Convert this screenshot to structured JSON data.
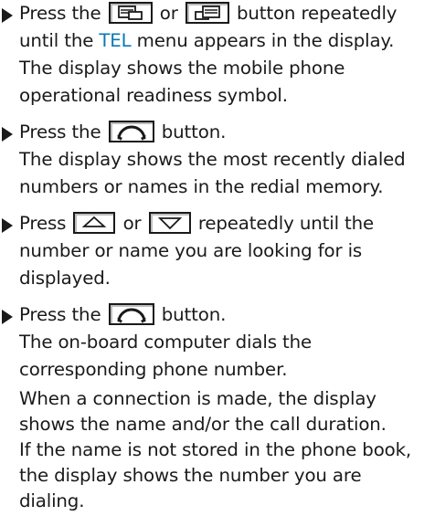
{
  "steps": [
    {
      "lines": [
        {
          "before": "Press the",
          "mid": "or",
          "after": "button repeatedly"
        },
        {
          "before": "until the",
          "highlight": "TEL",
          "after": "menu appears in the display."
        },
        {
          "text": "The display shows the mobile phone"
        },
        {
          "text": "operational readiness symbol."
        }
      ]
    },
    {
      "lines": [
        {
          "before": "Press the",
          "after": "button."
        },
        {
          "text": "The display shows the most recently dialed"
        },
        {
          "text": "numbers or names in the redial memory."
        }
      ]
    },
    {
      "lines": [
        {
          "before": "Press",
          "mid": "or",
          "after": "repeatedly until the"
        },
        {
          "text": "number or name you are looking for is"
        },
        {
          "text": "displayed."
        }
      ]
    },
    {
      "lines": [
        {
          "before": "Press the",
          "after": "button."
        },
        {
          "text": "The on-board computer dials the"
        },
        {
          "text": "corresponding phone number."
        }
      ]
    }
  ],
  "note": {
    "lines": [
      "When a connection is made, the display",
      "shows the name and/or the call duration.",
      "If the name is not stored in the phone book,",
      "the display shows the number you are",
      "dialing."
    ]
  },
  "icons": {
    "menu_back": "display-menu-back-icon",
    "menu_forward": "display-menu-forward-icon",
    "phone": "phone-handset-icon",
    "up": "arrow-up-icon",
    "down": "arrow-down-icon"
  },
  "colors": {
    "text": "#1a1a1a",
    "highlight": "#0a78b4"
  }
}
